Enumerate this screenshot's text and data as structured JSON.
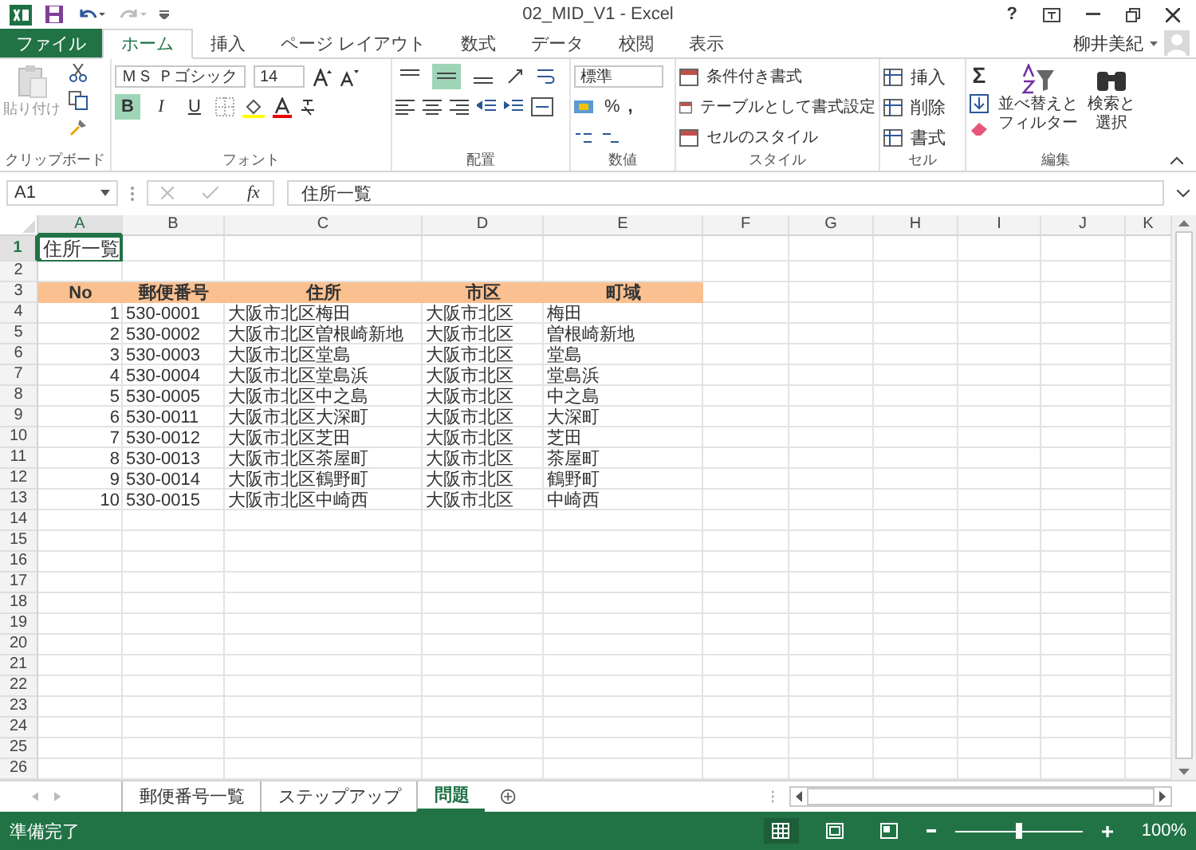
{
  "window": {
    "title": "02_MID_V1 - Excel",
    "help": "?",
    "user": "柳井美紀"
  },
  "tabs": [
    {
      "label": "ファイル",
      "kind": "file",
      "selected": false
    },
    {
      "label": "ホーム",
      "kind": "tab",
      "selected": true
    },
    {
      "label": "挿入",
      "kind": "tab",
      "selected": false
    },
    {
      "label": "ページ レイアウト",
      "kind": "tab",
      "selected": false
    },
    {
      "label": "数式",
      "kind": "tab",
      "selected": false
    },
    {
      "label": "データ",
      "kind": "tab",
      "selected": false
    },
    {
      "label": "校閲",
      "kind": "tab",
      "selected": false
    },
    {
      "label": "表示",
      "kind": "tab",
      "selected": false
    }
  ],
  "ribbon": {
    "clipboard": {
      "paste": "貼り付け",
      "label": "クリップボード"
    },
    "font": {
      "name": "ＭＳ Ｐゴシック",
      "size": "14",
      "styles": [
        {
          "label": "B",
          "selected": true
        },
        {
          "label": "I",
          "selected": false
        },
        {
          "label": "U",
          "selected": false
        }
      ],
      "label": "フォント"
    },
    "alignment": {
      "vertical": [
        {
          "selected": false
        },
        {
          "selected": true
        },
        {
          "selected": false
        }
      ],
      "label": "配置"
    },
    "number": {
      "format": "標準",
      "percent": "%",
      "comma": ",",
      "label": "数値"
    },
    "styles": {
      "items": [
        "条件付き書式",
        "テーブルとして書式設定",
        "セルのスタイル"
      ],
      "label": "スタイル"
    },
    "cells": {
      "items": [
        "挿入",
        "削除",
        "書式"
      ],
      "label": "セル"
    },
    "editing": {
      "sum": "Σ",
      "sort": [
        "並べ替えと",
        "フィルター"
      ],
      "find": [
        "検索と",
        "選択"
      ],
      "label": "編集"
    }
  },
  "formula_bar": {
    "name_box": "A1",
    "function_label": "fx",
    "content": "住所一覧"
  },
  "sheet": {
    "columns": [
      {
        "label": "A",
        "selected": true
      },
      {
        "label": "B",
        "selected": false
      },
      {
        "label": "C",
        "selected": false
      },
      {
        "label": "D",
        "selected": false
      },
      {
        "label": "E",
        "selected": false
      },
      {
        "label": "F",
        "selected": false
      },
      {
        "label": "G",
        "selected": false
      },
      {
        "label": "H",
        "selected": false
      },
      {
        "label": "I",
        "selected": false
      },
      {
        "label": "J",
        "selected": false
      },
      {
        "label": "K",
        "selected": false
      }
    ],
    "rows": [
      {
        "label": "1",
        "selected": true
      },
      {
        "label": "2",
        "selected": false
      },
      {
        "label": "3",
        "selected": false
      },
      {
        "label": "4",
        "selected": false
      },
      {
        "label": "5",
        "selected": false
      },
      {
        "label": "6",
        "selected": false
      },
      {
        "label": "7",
        "selected": false
      },
      {
        "label": "8",
        "selected": false
      },
      {
        "label": "9",
        "selected": false
      },
      {
        "label": "10",
        "selected": false
      },
      {
        "label": "11",
        "selected": false
      },
      {
        "label": "12",
        "selected": false
      },
      {
        "label": "13",
        "selected": false
      },
      {
        "label": "14",
        "selected": false
      },
      {
        "label": "15",
        "selected": false
      },
      {
        "label": "16",
        "selected": false
      },
      {
        "label": "17",
        "selected": false
      },
      {
        "label": "18",
        "selected": false
      },
      {
        "label": "19",
        "selected": false
      },
      {
        "label": "20",
        "selected": false
      },
      {
        "label": "21",
        "selected": false
      },
      {
        "label": "22",
        "selected": false
      },
      {
        "label": "23",
        "selected": false
      },
      {
        "label": "24",
        "selected": false
      },
      {
        "label": "25",
        "selected": false
      },
      {
        "label": "26",
        "selected": false
      }
    ],
    "title": "住所一覧",
    "table": {
      "columns": [
        "No",
        "郵便番号",
        "住所",
        "市区",
        "町域"
      ],
      "rows": [
        [
          "1",
          "530-0001",
          "大阪市北区梅田",
          "大阪市北区",
          "梅田"
        ],
        [
          "2",
          "530-0002",
          "大阪市北区曽根崎新地",
          "大阪市北区",
          "曽根崎新地"
        ],
        [
          "3",
          "530-0003",
          "大阪市北区堂島",
          "大阪市北区",
          "堂島"
        ],
        [
          "4",
          "530-0004",
          "大阪市北区堂島浜",
          "大阪市北区",
          "堂島浜"
        ],
        [
          "5",
          "530-0005",
          "大阪市北区中之島",
          "大阪市北区",
          "中之島"
        ],
        [
          "6",
          "530-0011",
          "大阪市北区大深町",
          "大阪市北区",
          "大深町"
        ],
        [
          "7",
          "530-0012",
          "大阪市北区芝田",
          "大阪市北区",
          "芝田"
        ],
        [
          "8",
          "530-0013",
          "大阪市北区茶屋町",
          "大阪市北区",
          "茶屋町"
        ],
        [
          "9",
          "530-0014",
          "大阪市北区鶴野町",
          "大阪市北区",
          "鶴野町"
        ],
        [
          "10",
          "530-0015",
          "大阪市北区中崎西",
          "大阪市北区",
          "中崎西"
        ]
      ]
    }
  },
  "sheet_tabs": [
    {
      "label": "郵便番号一覧",
      "selected": false
    },
    {
      "label": "ステップアップ",
      "selected": false
    },
    {
      "label": "問題",
      "selected": true
    }
  ],
  "status_bar": {
    "status": "準備完了",
    "views": [
      {
        "kind": "normal",
        "selected": true
      },
      {
        "kind": "page_layout",
        "selected": false
      },
      {
        "kind": "page_break",
        "selected": false
      }
    ],
    "zoom": {
      "level": 0.5,
      "reading": "100%"
    }
  }
}
